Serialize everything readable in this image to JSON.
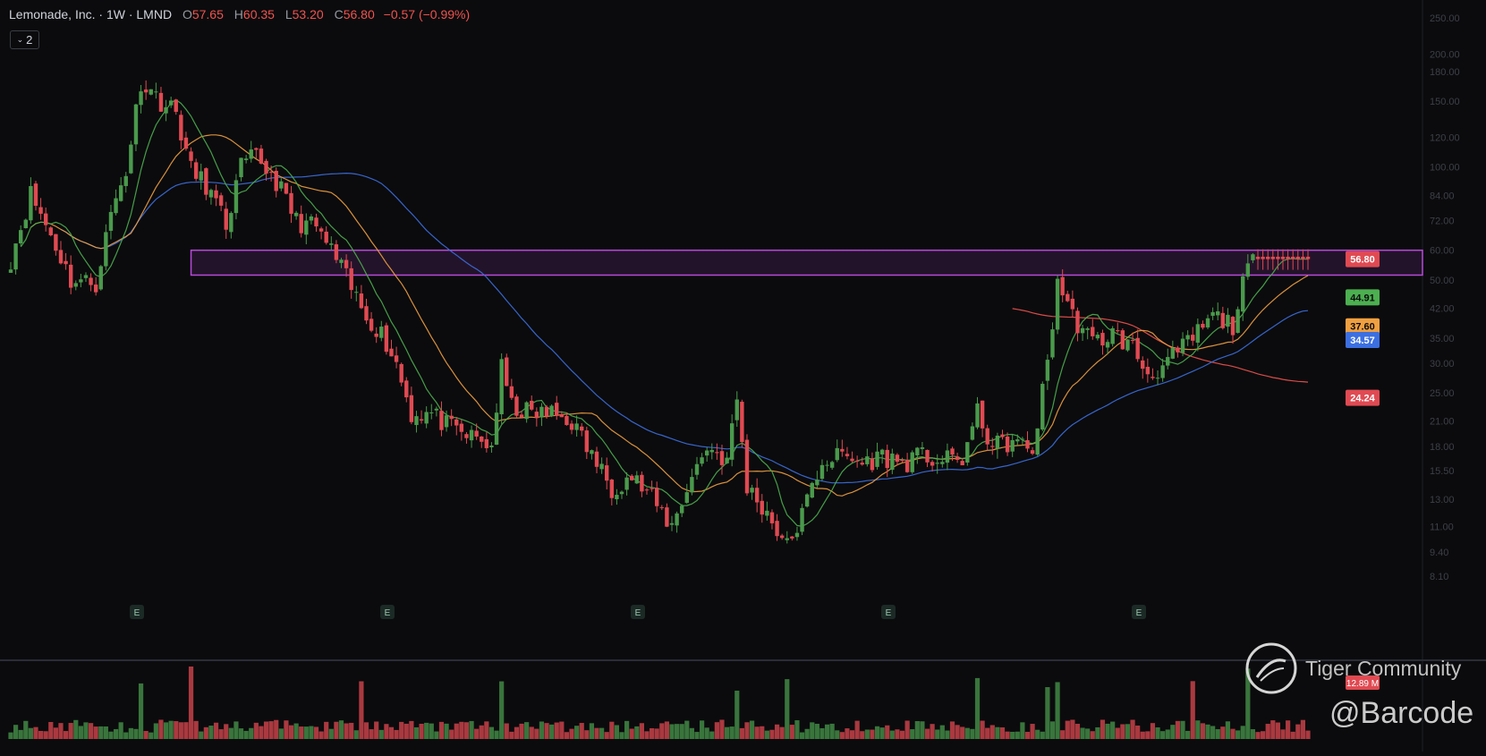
{
  "header": {
    "title": "Lemonade, Inc. · 1W · LMND",
    "open_key": "O",
    "open": "57.65",
    "high_key": "H",
    "high": "60.35",
    "low_key": "L",
    "low": "53.20",
    "close_key": "C",
    "close": "56.80",
    "change": "−0.57 (−0.99%)",
    "collapse_count": "2"
  },
  "colors": {
    "background": "#0b0b0d",
    "up": "#4a9a4c",
    "down": "#e04a52",
    "ma_green": "#4caf50",
    "ma_orange": "#f0a040",
    "ma_blue": "#3c6fe0",
    "ma_red": "#ef5350",
    "zone": "#b84ad9"
  },
  "chart_data": {
    "type": "candlestick",
    "symbol": "LMND",
    "interval": "1W",
    "y_scale": "log",
    "ylim": [
      5.7,
      270
    ],
    "y_ticks": [
      "250.00",
      "200.00",
      "180.00",
      "150.00",
      "120.00",
      "100.00",
      "84.00",
      "72.00",
      "60.00",
      "50.00",
      "42.00",
      "35.00",
      "30.00",
      "25.00",
      "21.00",
      "18.00",
      "15.50",
      "13.00",
      "11.00",
      "9.40",
      "8.10"
    ],
    "x_bars": 260,
    "earnings_markers": [
      "E",
      "E",
      "E",
      "E",
      "E"
    ],
    "resistance_zone": [
      51.5,
      60.0
    ],
    "last_price_label": "56.80",
    "ma_labels": [
      "44.91",
      "37.60",
      "34.57",
      "24.24"
    ],
    "volume_label": "12.89 M",
    "anchors": [
      [
        0,
        57
      ],
      [
        4,
        85
      ],
      [
        8,
        66
      ],
      [
        12,
        50
      ],
      [
        17,
        49
      ],
      [
        20,
        75
      ],
      [
        23,
        98
      ],
      [
        26,
        170
      ],
      [
        30,
        150
      ],
      [
        33,
        140
      ],
      [
        36,
        98
      ],
      [
        39,
        90
      ],
      [
        43,
        70
      ],
      [
        46,
        100
      ],
      [
        49,
        107
      ],
      [
        53,
        92
      ],
      [
        57,
        72
      ],
      [
        61,
        69
      ],
      [
        65,
        57
      ],
      [
        70,
        42
      ],
      [
        74,
        36
      ],
      [
        77,
        30
      ],
      [
        80,
        22
      ],
      [
        84,
        22
      ],
      [
        88,
        20
      ],
      [
        92,
        19
      ],
      [
        96,
        18
      ],
      [
        98,
        29
      ],
      [
        100,
        23
      ],
      [
        104,
        22
      ],
      [
        108,
        22
      ],
      [
        112,
        21
      ],
      [
        116,
        17
      ],
      [
        120,
        14
      ],
      [
        124,
        15
      ],
      [
        128,
        13
      ],
      [
        132,
        11
      ],
      [
        135,
        14
      ],
      [
        139,
        18
      ],
      [
        143,
        16.5
      ],
      [
        145,
        24
      ],
      [
        147,
        14
      ],
      [
        151,
        12
      ],
      [
        155,
        9.7
      ],
      [
        158,
        11.8
      ],
      [
        162,
        16.5
      ],
      [
        166,
        17
      ],
      [
        170,
        16.2
      ],
      [
        174,
        17
      ],
      [
        178,
        16.2
      ],
      [
        182,
        17
      ],
      [
        186,
        16.4
      ],
      [
        190,
        16.7
      ],
      [
        193,
        22
      ],
      [
        196,
        18
      ],
      [
        200,
        18.5
      ],
      [
        204,
        17.5
      ],
      [
        207,
        30
      ],
      [
        209,
        50
      ],
      [
        212,
        40
      ],
      [
        216,
        34
      ],
      [
        220,
        36
      ],
      [
        224,
        33
      ],
      [
        227,
        28
      ],
      [
        231,
        30
      ],
      [
        236,
        35
      ],
      [
        240,
        40
      ],
      [
        244,
        38
      ],
      [
        247,
        54
      ],
      [
        249,
        56.8
      ]
    ]
  }
}
